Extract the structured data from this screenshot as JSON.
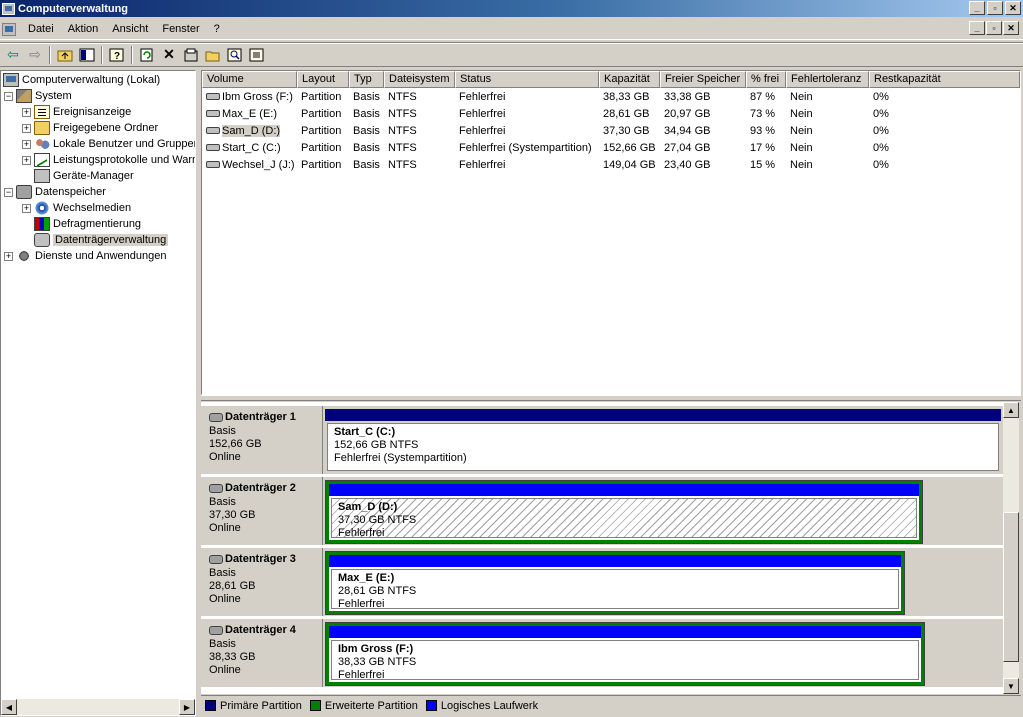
{
  "window": {
    "title": "Computerverwaltung",
    "buttons": {
      "minimize": "_",
      "maximize": "▫",
      "close": "✕"
    }
  },
  "menu": {
    "items": [
      "Datei",
      "Aktion",
      "Ansicht",
      "Fenster",
      "?"
    ]
  },
  "toolbar": {
    "icons": [
      "back-arrow-icon",
      "forward-arrow-icon",
      "up-folder-icon",
      "show-hide-tree-icon",
      "help-icon",
      "refresh-icon",
      "delete-icon",
      "properties-icon",
      "open-icon",
      "search-icon",
      "export-icon"
    ]
  },
  "tree": {
    "root": "Computerverwaltung (Lokal)",
    "system": "System",
    "event_viewer": "Ereignisanzeige",
    "shared_folders": "Freigegebene Ordner",
    "local_users": "Lokale Benutzer und Gruppen",
    "perf_logs": "Leistungsprotokolle und Warnungen",
    "device_manager": "Geräte-Manager",
    "storage": "Datenspeicher",
    "removable": "Wechselmedien",
    "defrag": "Defragmentierung",
    "disk_mgmt": "Datenträgerverwaltung",
    "services": "Dienste und Anwendungen"
  },
  "list": {
    "columns": [
      "Volume",
      "Layout",
      "Typ",
      "Dateisystem",
      "Status",
      "Kapazität",
      "Freier Speicher",
      "% frei",
      "Fehlertoleranz",
      "Restkapazität"
    ],
    "rows": [
      [
        "Ibm Gross (F:)",
        "Partition",
        "Basis",
        "NTFS",
        "Fehlerfrei",
        "38,33 GB",
        "33,38 GB",
        "87 %",
        "Nein",
        "0%"
      ],
      [
        "Max_E (E:)",
        "Partition",
        "Basis",
        "NTFS",
        "Fehlerfrei",
        "28,61 GB",
        "20,97 GB",
        "73 %",
        "Nein",
        "0%"
      ],
      [
        "Sam_D (D:)",
        "Partition",
        "Basis",
        "NTFS",
        "Fehlerfrei",
        "37,30 GB",
        "34,94 GB",
        "93 %",
        "Nein",
        "0%"
      ],
      [
        "Start_C (C:)",
        "Partition",
        "Basis",
        "NTFS",
        "Fehlerfrei (Systempartition)",
        "152,66 GB",
        "27,04 GB",
        "17 %",
        "Nein",
        "0%"
      ],
      [
        "Wechsel_J (J:)",
        "Partition",
        "Basis",
        "NTFS",
        "Fehlerfrei",
        "149,04 GB",
        "23,40 GB",
        "15 %",
        "Nein",
        "0%"
      ]
    ]
  },
  "disks": [
    {
      "title": "Datenträger 1",
      "type": "Basis",
      "size": "152,66 GB",
      "state": "Online",
      "part_name": "Start_C  (C:)",
      "part_size": "152,66 GB NTFS",
      "part_status": "Fehlerfrei (Systempartition)"
    },
    {
      "title": "Datenträger 2",
      "type": "Basis",
      "size": "37,30 GB",
      "state": "Online",
      "part_name": "Sam_D  (D:)",
      "part_size": "37,30 GB NTFS",
      "part_status": "Fehlerfrei"
    },
    {
      "title": "Datenträger 3",
      "type": "Basis",
      "size": "28,61 GB",
      "state": "Online",
      "part_name": "Max_E  (E:)",
      "part_size": "28,61 GB NTFS",
      "part_status": "Fehlerfrei"
    },
    {
      "title": "Datenträger 4",
      "type": "Basis",
      "size": "38,33 GB",
      "state": "Online",
      "part_name": "Ibm Gross  (F:)",
      "part_size": "38,33 GB NTFS",
      "part_status": "Fehlerfrei"
    }
  ],
  "legend": {
    "primary": "Primäre Partition",
    "extended": "Erweiterte Partition",
    "logical": "Logisches Laufwerk"
  },
  "colors": {
    "primary": "#000080",
    "extended": "#008000",
    "logical": "#0000ff",
    "title_bar": "#0a246a"
  }
}
